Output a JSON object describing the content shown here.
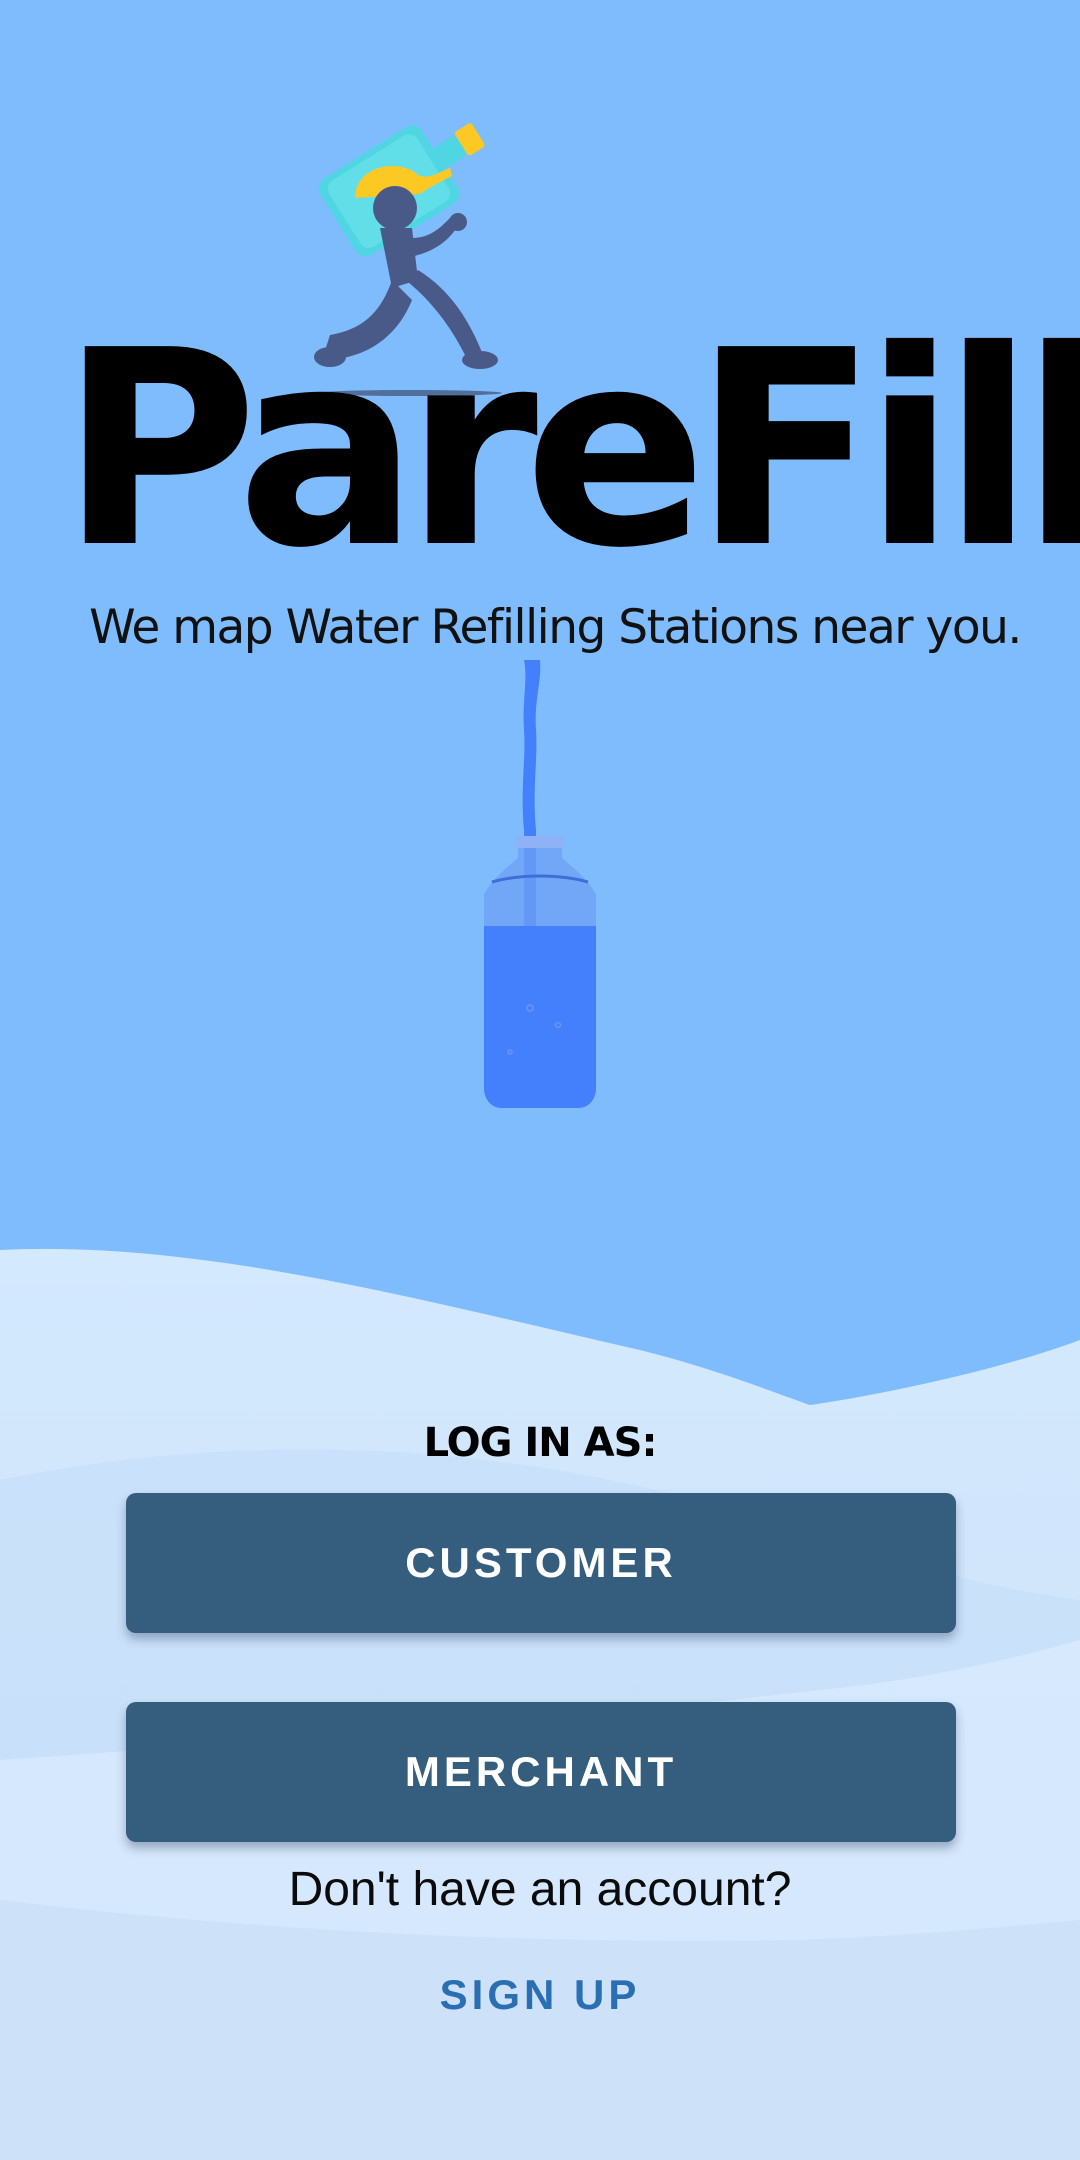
{
  "app": {
    "title": "PareFill",
    "tagline": "We map Water Refilling Stations near you."
  },
  "login": {
    "label": "LOG IN AS:",
    "customer_label": "CUSTOMER",
    "merchant_label": "MERCHANT"
  },
  "signup": {
    "prompt": "Don't have an account?",
    "link_label": "SIGN UP"
  },
  "icons": {
    "mascot": "delivery-man-carrying-water-jug-icon",
    "bottle": "water-bottle-filling-icon"
  },
  "colors": {
    "background": "#7fbcfd",
    "button": "#345d7e",
    "button_text": "#ffffff",
    "link": "#2a6fb3",
    "bottle_water": "#4480fb",
    "hat": "#fbc824",
    "jug": "#4fd6e2",
    "figure": "#4a5a88"
  }
}
